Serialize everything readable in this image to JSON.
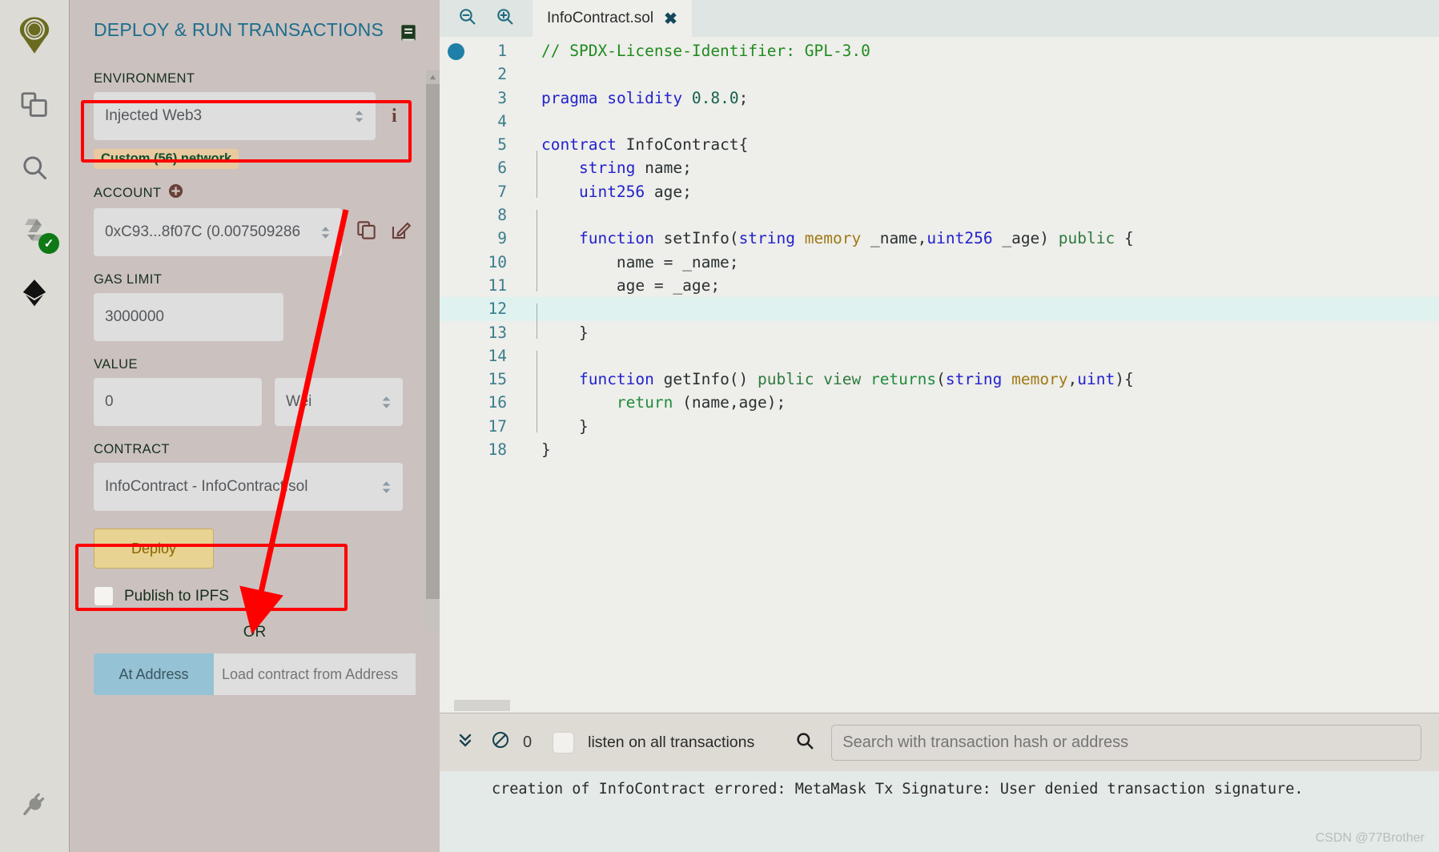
{
  "rail": {
    "items": [
      {
        "name": "remix-logo",
        "label": "Remix"
      },
      {
        "name": "file-explorer-icon",
        "label": "File explorers"
      },
      {
        "name": "search-icon",
        "label": "Search in files"
      },
      {
        "name": "solidity-compiler-icon",
        "label": "Solidity compiler"
      },
      {
        "name": "deploy-run-icon",
        "label": "Deploy & run transactions"
      },
      {
        "name": "plugin-manager-icon",
        "label": "Plugin manager"
      }
    ]
  },
  "panel": {
    "title": "DEPLOY & RUN TRANSACTIONS",
    "book_icon": "contract-docs-icon",
    "environment": {
      "label": "ENVIRONMENT",
      "value": "Injected Web3",
      "info_icon": "i",
      "network_badge": "Custom (56) network"
    },
    "account": {
      "label": "ACCOUNT",
      "plus_icon": "+",
      "value": "0xC93...8f07C (0.007509286",
      "copy_icon": "copy-icon",
      "edit_icon": "edit-icon"
    },
    "gas_limit": {
      "label": "GAS LIMIT",
      "value": "3000000"
    },
    "value_field": {
      "label": "VALUE",
      "value": "0",
      "unit": "Wei"
    },
    "contract": {
      "label": "CONTRACT",
      "value": "InfoContract - InfoContract.sol"
    },
    "deploy_button": "Deploy",
    "publish_ipfs": "Publish to IPFS",
    "or": "OR",
    "at_address_button": "At Address",
    "at_address_placeholder": "Load contract from Address"
  },
  "editor": {
    "zoom_out_icon": "zoom-out-icon",
    "zoom_in_icon": "zoom-in-icon",
    "tab": {
      "label": "InfoContract.sol",
      "close": "✖"
    },
    "lines": [
      {
        "n": "1",
        "tokens": [
          {
            "t": "// SPDX-License-Identifier: GPL-3.0",
            "c": "k-comment"
          }
        ]
      },
      {
        "n": "2",
        "tokens": []
      },
      {
        "n": "3",
        "tokens": [
          {
            "t": "pragma",
            "c": "k-kw"
          },
          {
            "t": " ",
            "c": "k-plain"
          },
          {
            "t": "solidity",
            "c": "k-kw"
          },
          {
            "t": " ",
            "c": "k-plain"
          },
          {
            "t": "0.8.0",
            "c": "k-num"
          },
          {
            "t": ";",
            "c": "k-plain"
          }
        ]
      },
      {
        "n": "4",
        "tokens": []
      },
      {
        "n": "5",
        "tokens": [
          {
            "t": "contract",
            "c": "k-kw"
          },
          {
            "t": " ",
            "c": "k-plain"
          },
          {
            "t": "InfoContract",
            "c": "k-plain"
          },
          {
            "t": "{",
            "c": "k-plain"
          }
        ]
      },
      {
        "n": "6",
        "tokens": [
          {
            "t": "    ",
            "c": "k-plain"
          },
          {
            "t": "string",
            "c": "k-type"
          },
          {
            "t": " name;",
            "c": "k-plain"
          }
        ],
        "indent": true
      },
      {
        "n": "7",
        "tokens": [
          {
            "t": "    ",
            "c": "k-plain"
          },
          {
            "t": "uint256",
            "c": "k-type"
          },
          {
            "t": " age;",
            "c": "k-plain"
          }
        ],
        "indent": true
      },
      {
        "n": "8",
        "tokens": [],
        "indent": true
      },
      {
        "n": "9",
        "tokens": [
          {
            "t": "    ",
            "c": "k-plain"
          },
          {
            "t": "function",
            "c": "k-fn"
          },
          {
            "t": " setInfo",
            "c": "k-plain"
          },
          {
            "t": "(",
            "c": "k-plain"
          },
          {
            "t": "string",
            "c": "k-type"
          },
          {
            "t": " ",
            "c": "k-plain"
          },
          {
            "t": "memory",
            "c": "k-mem"
          },
          {
            "t": " _name,",
            "c": "k-plain"
          },
          {
            "t": "uint256",
            "c": "k-type"
          },
          {
            "t": " _age) ",
            "c": "k-plain"
          },
          {
            "t": "public",
            "c": "k-pub"
          },
          {
            "t": " {",
            "c": "k-plain"
          }
        ],
        "indent": true
      },
      {
        "n": "10",
        "tokens": [
          {
            "t": "        name = _name;",
            "c": "k-plain"
          }
        ],
        "indent": true
      },
      {
        "n": "11",
        "tokens": [
          {
            "t": "        age = _age;",
            "c": "k-plain"
          }
        ],
        "indent": true
      },
      {
        "n": "12",
        "tokens": [],
        "indent": true,
        "active": true
      },
      {
        "n": "13",
        "tokens": [
          {
            "t": "    }",
            "c": "k-plain"
          }
        ],
        "indent": true
      },
      {
        "n": "14",
        "tokens": [],
        "indent": true
      },
      {
        "n": "15",
        "tokens": [
          {
            "t": "    ",
            "c": "k-plain"
          },
          {
            "t": "function",
            "c": "k-fn"
          },
          {
            "t": " getInfo() ",
            "c": "k-plain"
          },
          {
            "t": "public",
            "c": "k-pub"
          },
          {
            "t": " ",
            "c": "k-plain"
          },
          {
            "t": "view",
            "c": "k-pub"
          },
          {
            "t": " ",
            "c": "k-plain"
          },
          {
            "t": "returns",
            "c": "k-ret"
          },
          {
            "t": "(",
            "c": "k-plain"
          },
          {
            "t": "string",
            "c": "k-type"
          },
          {
            "t": " ",
            "c": "k-plain"
          },
          {
            "t": "memory",
            "c": "k-mem"
          },
          {
            "t": ",",
            "c": "k-plain"
          },
          {
            "t": "uint",
            "c": "k-type"
          },
          {
            "t": "){",
            "c": "k-plain"
          }
        ],
        "indent": true
      },
      {
        "n": "16",
        "tokens": [
          {
            "t": "        ",
            "c": "k-plain"
          },
          {
            "t": "return",
            "c": "k-ret"
          },
          {
            "t": " (name,age);",
            "c": "k-plain"
          }
        ],
        "indent": true
      },
      {
        "n": "17",
        "tokens": [
          {
            "t": "    }",
            "c": "k-plain"
          }
        ],
        "indent": true
      },
      {
        "n": "18",
        "tokens": [
          {
            "t": "}",
            "c": "k-plain"
          }
        ]
      }
    ]
  },
  "terminal": {
    "chevron_icon": "chevron-double-down-icon",
    "clear_icon": "clear-console-icon",
    "count": "0",
    "listen_label": "listen on all transactions",
    "search_icon": "search-icon",
    "search_placeholder": "Search with transaction hash or address",
    "log": "creation of InfoContract errored: MetaMask Tx Signature: User denied transaction signature.",
    "watermark": "CSDN @77Brother"
  },
  "colors": {
    "highlight": "#fe0000",
    "panel_bg": "#cbc1bf",
    "accent_title": "#1c6e8c",
    "deploy_bg": "#e8d392",
    "at_address_bg": "#95c2d4",
    "badge_bg": "#e8c9a0"
  }
}
